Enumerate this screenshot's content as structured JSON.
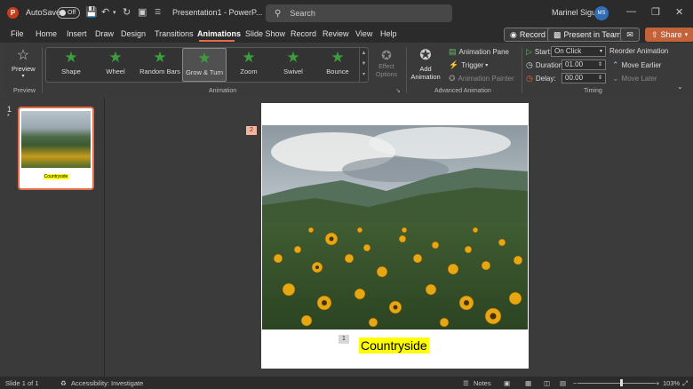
{
  "titlebar": {
    "logo": "P",
    "autosave_label": "AutoSave",
    "autosave_state": "Off",
    "doc_title": "Presentation1 - PowerP...",
    "search_placeholder": "Search",
    "user_name": "Marinel Sigue",
    "user_initials": "MS"
  },
  "menu": {
    "items": [
      "File",
      "Home",
      "Insert",
      "Draw",
      "Design",
      "Transitions",
      "Animations",
      "Slide Show",
      "Record",
      "Review",
      "View",
      "Help"
    ],
    "active": "Animations",
    "record_button": "Record",
    "present_button": "Present in Teams",
    "share_button": "Share"
  },
  "ribbon": {
    "preview_label": "Preview",
    "preview_group": "Preview",
    "animations": [
      {
        "label": "Shape"
      },
      {
        "label": "Wheel"
      },
      {
        "label": "Random Bars"
      },
      {
        "label": "Grow & Turn"
      },
      {
        "label": "Zoom"
      },
      {
        "label": "Swivel"
      },
      {
        "label": "Bounce"
      }
    ],
    "selected_animation": "Grow & Turn",
    "effect_options_label": "Effect Options",
    "animation_group": "Animation",
    "add_animation_label": "Add Animation",
    "animation_pane_label": "Animation Pane",
    "trigger_label": "Trigger",
    "animation_painter_label": "Animation Painter",
    "advanced_group": "Advanced Animation",
    "start_label": "Start:",
    "start_value": "On Click",
    "duration_label": "Duration:",
    "duration_value": "01.00",
    "delay_label": "Delay:",
    "delay_value": "00.00",
    "reorder_label": "Reorder Animation",
    "move_earlier_label": "Move Earlier",
    "move_later_label": "Move Later",
    "timing_group": "Timing"
  },
  "thumbnails": {
    "slide_number": "1",
    "marker": "*",
    "caption": "Countryside"
  },
  "slide": {
    "caption": "Countryside",
    "tag_picture": "2",
    "tag_caption": "1"
  },
  "status": {
    "slide_info": "Slide 1 of 1",
    "accessibility": "Accessibility: Investigate",
    "notes_label": "Notes",
    "zoom": "103%"
  },
  "colors": {
    "accent": "#e46c4a",
    "star_green": "#3b9e3b",
    "highlight": "#ffff00"
  }
}
